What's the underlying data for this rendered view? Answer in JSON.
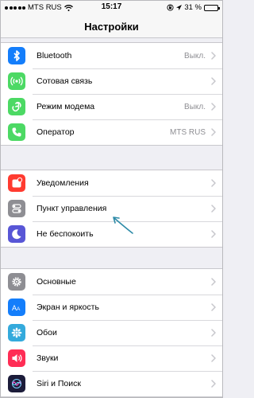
{
  "status_bar": {
    "carrier": "MTS RUS",
    "time": "15:17",
    "battery": "31 %",
    "battery_level": 0.31
  },
  "nav": {
    "title": "Настройки"
  },
  "groups": [
    [
      {
        "label": "Bluetooth",
        "value": "Выкл.",
        "icon": "bluetooth-icon",
        "color": "#147efb"
      },
      {
        "label": "Сотовая связь",
        "value": "",
        "icon": "cellular-icon",
        "color": "#4cd964"
      },
      {
        "label": "Режим модема",
        "value": "Выкл.",
        "icon": "hotspot-icon",
        "color": "#4cd964"
      },
      {
        "label": "Оператор",
        "value": "MTS RUS",
        "icon": "phone-icon",
        "color": "#4cd964"
      }
    ],
    [
      {
        "label": "Уведомления",
        "value": "",
        "icon": "notifications-icon",
        "color": "#ff3b30"
      },
      {
        "label": "Пункт управления",
        "value": "",
        "icon": "control-center-icon",
        "color": "#8e8e93"
      },
      {
        "label": "Не беспокоить",
        "value": "",
        "icon": "moon-icon",
        "color": "#5856d6"
      }
    ],
    [
      {
        "label": "Основные",
        "value": "",
        "icon": "gear-icon",
        "color": "#8e8e93"
      },
      {
        "label": "Экран и яркость",
        "value": "",
        "icon": "display-icon",
        "color": "#147efb"
      },
      {
        "label": "Обои",
        "value": "",
        "icon": "wallpaper-icon",
        "color": "#34aadc"
      },
      {
        "label": "Звуки",
        "value": "",
        "icon": "sounds-icon",
        "color": "#ff2d55"
      },
      {
        "label": "Siri и Поиск",
        "value": "",
        "icon": "siri-icon",
        "color": "#1c1c3a"
      }
    ]
  ],
  "annotation": {
    "arrow_color": "#2e8ba8"
  }
}
